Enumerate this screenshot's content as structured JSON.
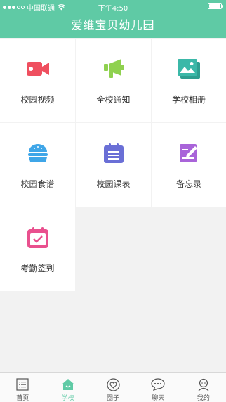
{
  "status_bar": {
    "carrier": "中国联通",
    "time": "下午4:50"
  },
  "nav": {
    "title": "爱维宝贝幼儿园"
  },
  "grid": {
    "items": [
      {
        "label": "校园视频",
        "icon": "video-camera-icon",
        "color": "#ef4f5f"
      },
      {
        "label": "全校通知",
        "icon": "megaphone-icon",
        "color": "#8fd14f"
      },
      {
        "label": "学校相册",
        "icon": "photo-album-icon",
        "color": "#3bb8a8"
      },
      {
        "label": "校园食谱",
        "icon": "burger-icon",
        "color": "#3fa6e8"
      },
      {
        "label": "校园课表",
        "icon": "calendar-list-icon",
        "color": "#6a6fd6"
      },
      {
        "label": "备忘录",
        "icon": "memo-edit-icon",
        "color": "#a964d9"
      },
      {
        "label": "考勤签到",
        "icon": "calendar-check-icon",
        "color": "#e9508e"
      }
    ]
  },
  "tab_bar": {
    "tabs": [
      {
        "label": "首页",
        "icon": "list-icon",
        "active": false
      },
      {
        "label": "学校",
        "icon": "home-icon",
        "active": true
      },
      {
        "label": "圈子",
        "icon": "heart-circle-icon",
        "active": false
      },
      {
        "label": "聊天",
        "icon": "chat-bubble-icon",
        "active": false
      },
      {
        "label": "我的",
        "icon": "profile-icon",
        "active": false
      }
    ],
    "active_color": "#5fcaa5"
  }
}
